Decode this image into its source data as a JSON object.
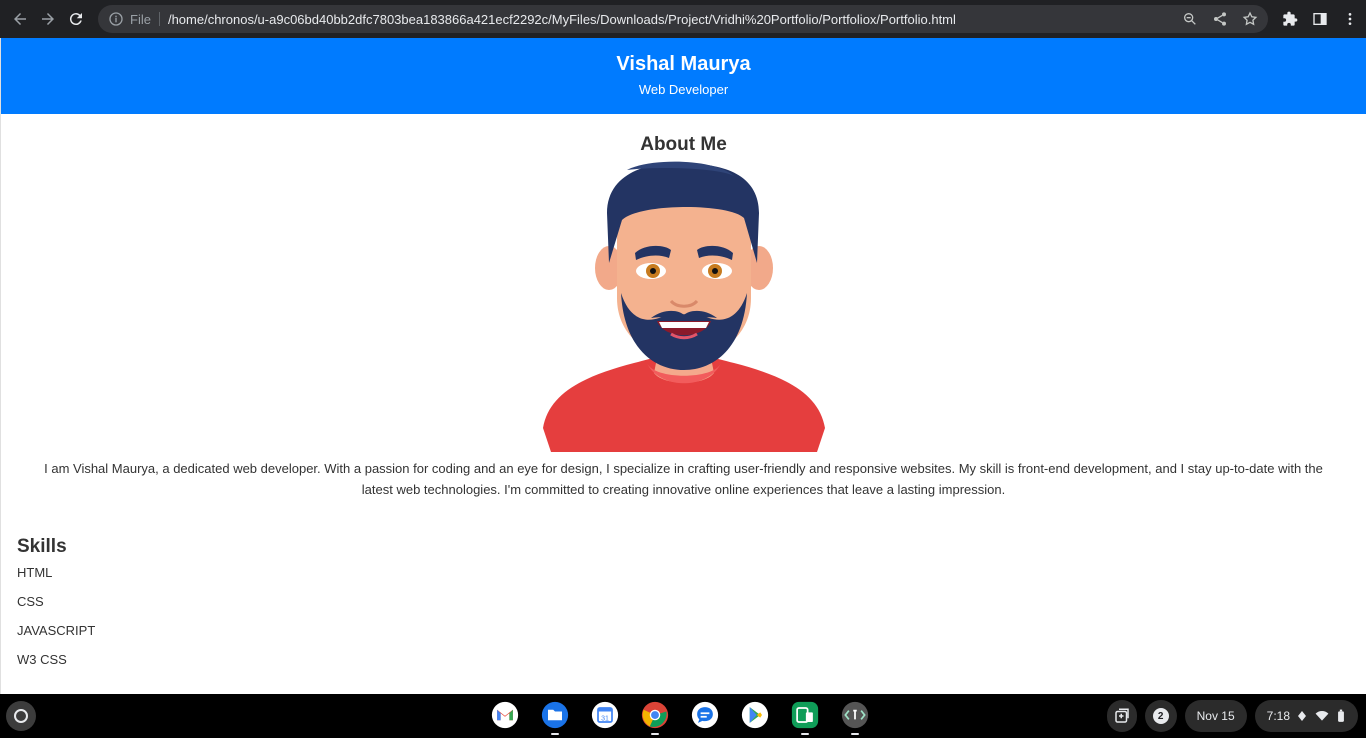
{
  "browser": {
    "file_label": "File",
    "url": "/home/chronos/u-a9c06bd40bb2dfc7803bea183866a421ecf2292c/MyFiles/Downloads/Project/Vridhi%20Portfolio/Portfoliox/Portfolio.html",
    "icons": [
      "back-icon",
      "forward-icon",
      "reload-icon",
      "info-icon",
      "zoom-icon",
      "share-icon",
      "bookmark-star-icon",
      "extensions-icon",
      "side-panel-icon",
      "menu-icon"
    ]
  },
  "header": {
    "name": "Vishal Maurya",
    "role": "Web Developer",
    "bg_color": "#007bff"
  },
  "about": {
    "title": "About Me",
    "text": "I am Vishal Maurya, a dedicated web developer. With a passion for coding and an eye for design, I specialize in crafting user-friendly and responsive websites. My skill is front-end development, and I stay up-to-date with the latest web technologies. I'm committed to creating innovative online experiences that leave a lasting impression."
  },
  "skills": {
    "title": "Skills",
    "items": [
      "HTML",
      "CSS",
      "JAVASCRIPT",
      "W3 CSS"
    ]
  },
  "taskbar": {
    "apps": [
      "gmail-icon",
      "files-icon",
      "calendar-icon",
      "chrome-icon",
      "messages-icon",
      "play-store-icon",
      "device-app-icon",
      "text-app-icon"
    ],
    "calendar_day": "31",
    "notification_count": "2",
    "date": "Nov 15",
    "time": "7:18"
  }
}
